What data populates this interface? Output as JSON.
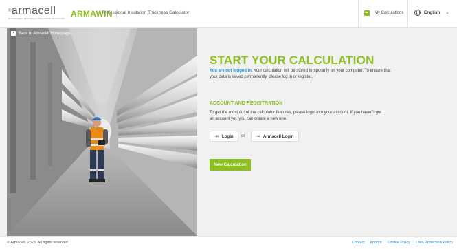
{
  "header": {
    "logo_text": "armacell",
    "logo_reg": "®",
    "logo_tagline": "ENGINEERED TECHNICAL INSULATION SOLUTIONS",
    "app_name": "ARMAWIN",
    "app_subtitle": "Professional Insulation Thickness Calculator",
    "my_calculations": "My Calculations",
    "language": "English",
    "icons": {
      "calc": "calculator-icon",
      "globe": "globe-icon",
      "chevron": "chevron-down-icon"
    }
  },
  "photo": {
    "back_label": "Back to Armacell Homepage"
  },
  "main": {
    "title": "START YOUR CALCULATION",
    "notice_highlight": "You are not logged in.",
    "notice_text": " Your calculation will be stored temporarily on your computer. To ensure that your data is saved permanently, please log in or register.",
    "section_title": "ACCOUNT AND REGISTRATION",
    "section_text": "To get the most out of the calculator features, please login into your account. If you haven't got an account yet, you can create a new one.",
    "login_label": "Login",
    "or_label": "or",
    "armacell_login_label": "Armacell Login",
    "new_calc_label": "New Calculation"
  },
  "footer": {
    "copyright": "© Armacell, 2023. All rights reserved.",
    "links": [
      "Contact",
      "Imprint",
      "Cookie Policy",
      "Data Protection Policy"
    ]
  },
  "colors": {
    "accent": "#8cbf1f",
    "link": "#1e8fd6",
    "background": "#f1f1f1"
  }
}
